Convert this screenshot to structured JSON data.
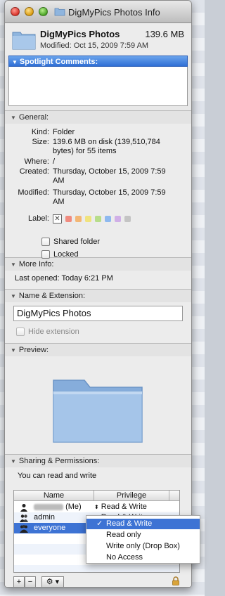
{
  "window": {
    "title": "DigMyPics Photos Info"
  },
  "header": {
    "name": "DigMyPics Photos",
    "size": "139.6 MB",
    "modified": "Modified: Oct 15, 2009 7:59 AM"
  },
  "spotlight": {
    "label": "Spotlight Comments:"
  },
  "general": {
    "heading": "General:",
    "kind_label": "Kind:",
    "kind_value": "Folder",
    "size_label": "Size:",
    "size_value_1": "139.6 MB on disk (139,510,784",
    "size_value_2": "bytes) for 55 items",
    "where_label": "Where:",
    "where_value": "/",
    "created_label": "Created:",
    "created_value_1": "Thursday, October 15, 2009 7:59",
    "created_value_2": "AM",
    "modified_label": "Modified:",
    "modified_value_1": "Thursday, October 15, 2009 7:59",
    "modified_value_2": "AM",
    "label_label": "Label:",
    "label_none_glyph": "✕",
    "label_colors": [
      "#f26b5b",
      "#f6a64e",
      "#f1e05a",
      "#a6d86a",
      "#6fa8f0",
      "#c79be6",
      "#b7b7b7"
    ],
    "shared_folder": "Shared folder",
    "locked": "Locked"
  },
  "more_info": {
    "heading": "More Info:",
    "last_opened": "Last opened: Today 6:21 PM"
  },
  "name_ext": {
    "heading": "Name & Extension:",
    "name_value": "DigMyPics Photos",
    "hide_extension": "Hide extension"
  },
  "preview": {
    "heading": "Preview:"
  },
  "sharing": {
    "heading": "Sharing & Permissions:",
    "summary": "You can read and write",
    "col_name": "Name",
    "col_privilege": "Privilege",
    "rows": [
      {
        "name_suffix": "(Me)",
        "privilege": "Read & Write"
      },
      {
        "name": "admin",
        "privilege": "Read & Write"
      },
      {
        "name": "everyone",
        "privilege": "Read & Write"
      }
    ],
    "updown_glyph": "⬍",
    "plus": "+",
    "minus": "−",
    "gear": "⚙ ▾"
  },
  "popup": {
    "check_glyph": "✓",
    "options": [
      "Read & Write",
      "Read only",
      "Write only (Drop Box)",
      "No Access"
    ],
    "selected_index": 0
  },
  "colors": {
    "selection_blue": "#3d73d4",
    "spotlight_bar": "#2f6fd6",
    "folder_blue": "#8fb5de"
  }
}
